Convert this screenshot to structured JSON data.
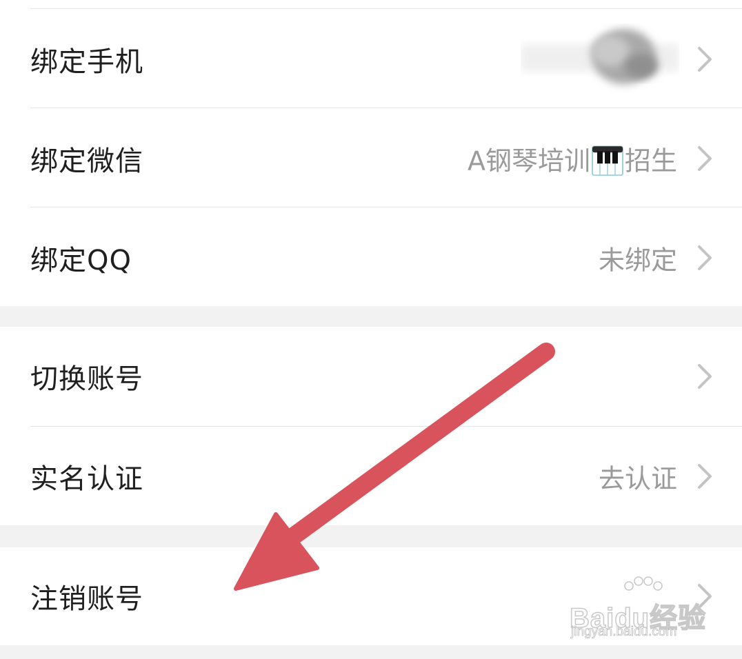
{
  "groups": [
    {
      "items": [
        {
          "label": "绑定手机",
          "value": ""
        },
        {
          "label": "绑定微信",
          "value_prefix": "A钢琴培训",
          "value_icon": "piano-emoji-icon",
          "value_suffix": "招生"
        },
        {
          "label": "绑定QQ",
          "value": "未绑定"
        }
      ]
    },
    {
      "items": [
        {
          "label": "切换账号",
          "value": ""
        },
        {
          "label": "实名认证",
          "value": "去认证"
        }
      ]
    },
    {
      "items": [
        {
          "label": "注销账号",
          "value": ""
        }
      ]
    }
  ],
  "overlay": {
    "arrow_color": "#d9535c"
  },
  "watermark": {
    "brand": "Baidu经验",
    "url": "jingyan.baidu.com"
  },
  "colors": {
    "background": "#f2f2f2",
    "surface": "#ffffff",
    "label": "#1f1f1f",
    "value": "#9a9a9a",
    "chevron": "#c4c4c4"
  }
}
